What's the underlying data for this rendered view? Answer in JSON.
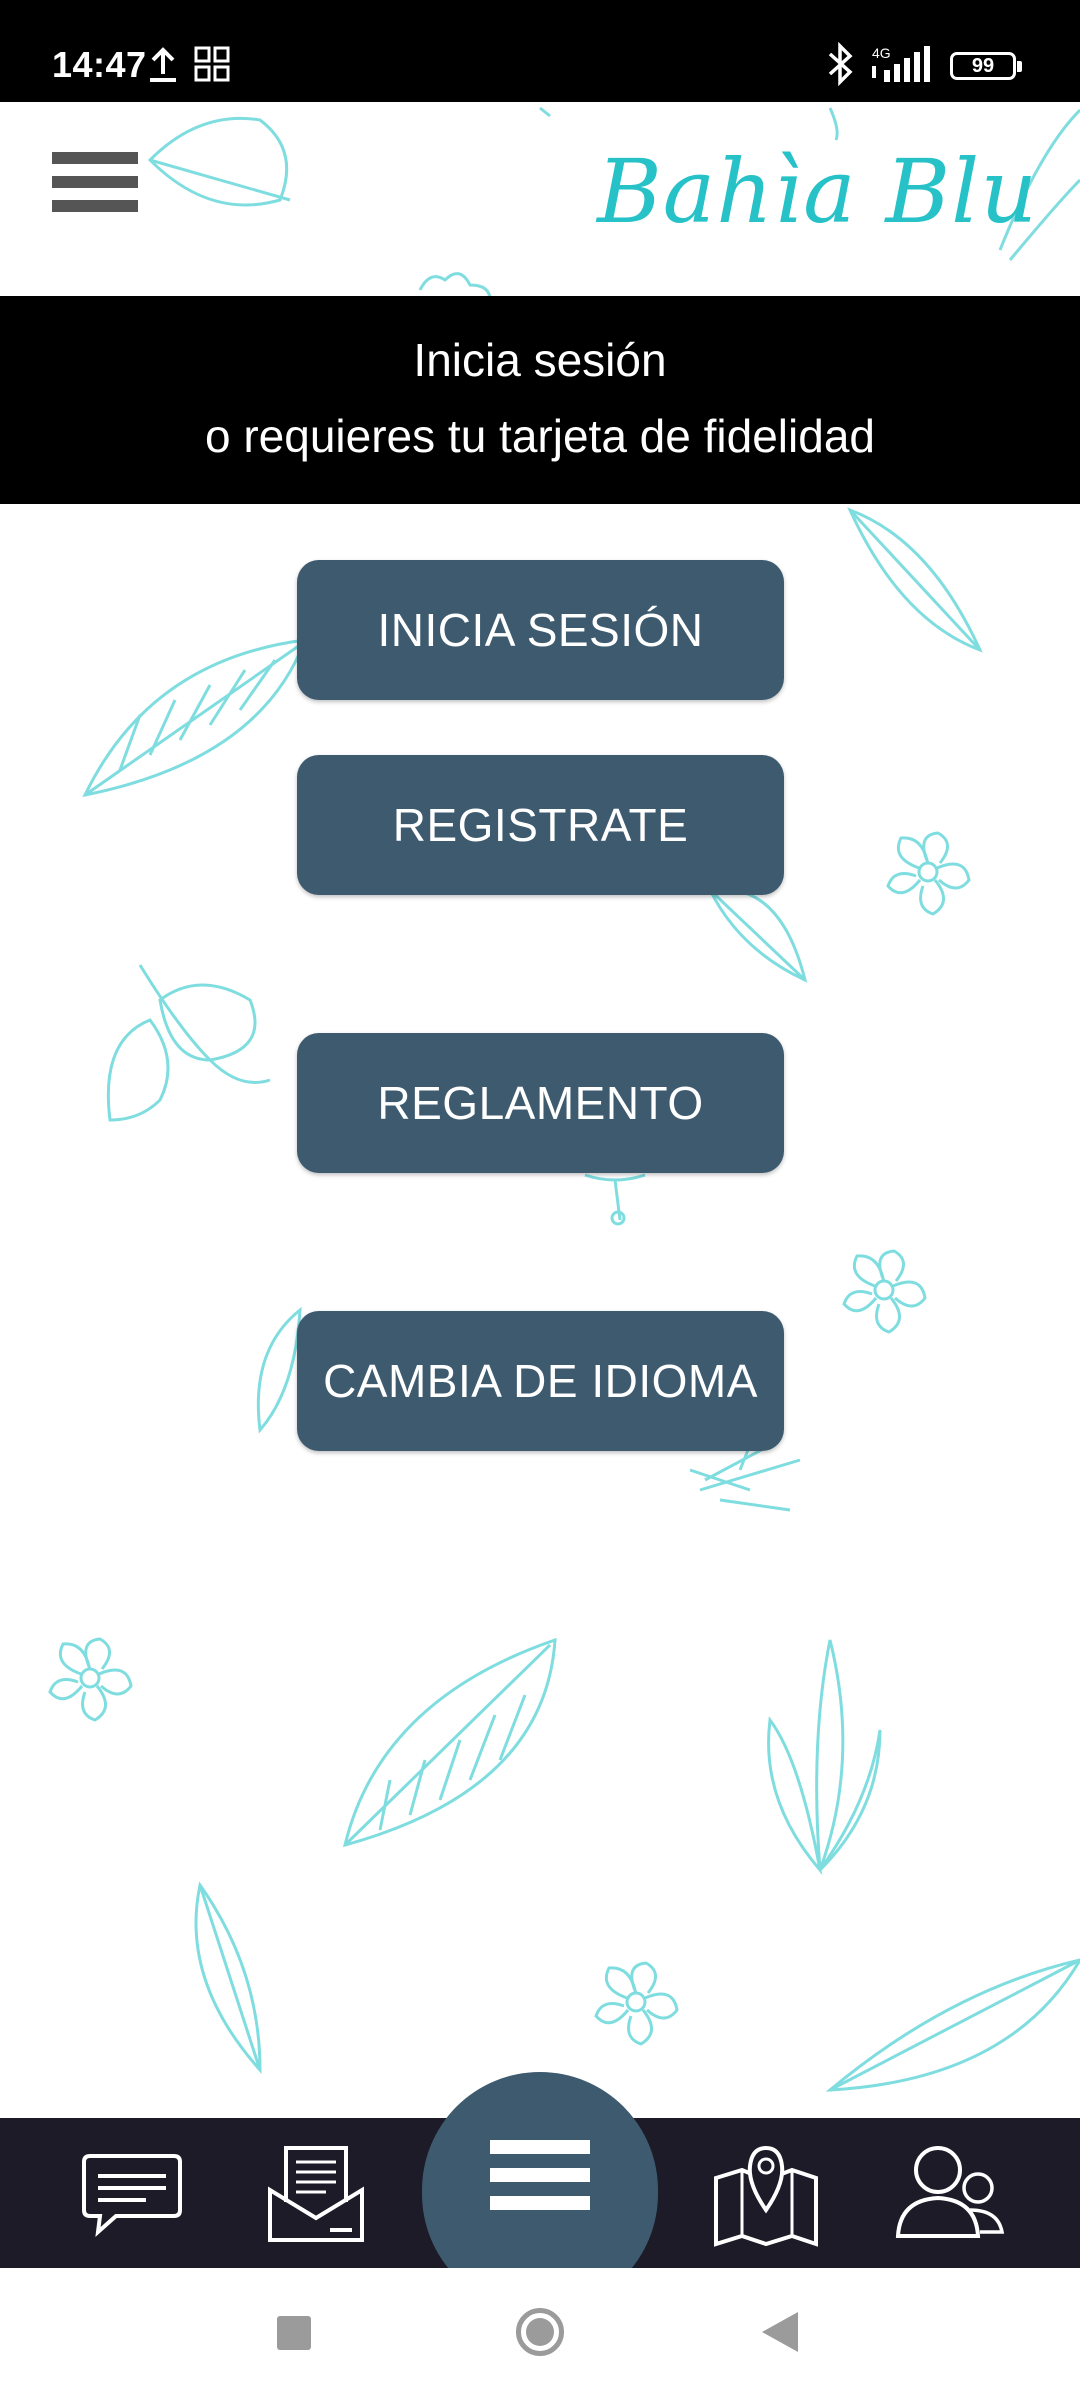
{
  "status_bar": {
    "time": "14:47",
    "battery": "99",
    "network": "4G"
  },
  "header": {
    "brand": "Bahìa Blu",
    "menu_icon": "hamburger-icon"
  },
  "banner": {
    "line1": "Inicia sesión",
    "line2": "o requieres tu tarjeta de fidelidad"
  },
  "buttons": {
    "login": "INICIA SESIÓN",
    "register": "REGISTRATE",
    "rules": "REGLAMENTO",
    "language": "CAMBIA DE IDIOMA"
  },
  "bottom_nav": {
    "items": [
      {
        "icon": "chat-icon"
      },
      {
        "icon": "mail-icon"
      },
      {
        "icon": "menu-icon"
      },
      {
        "icon": "map-icon"
      },
      {
        "icon": "users-icon"
      }
    ]
  },
  "colors": {
    "button": "#3d5a6f",
    "brand": "#26c2c7",
    "banner": "#000000",
    "nav": "#1c1b27",
    "decoration": "#7fdde0"
  }
}
